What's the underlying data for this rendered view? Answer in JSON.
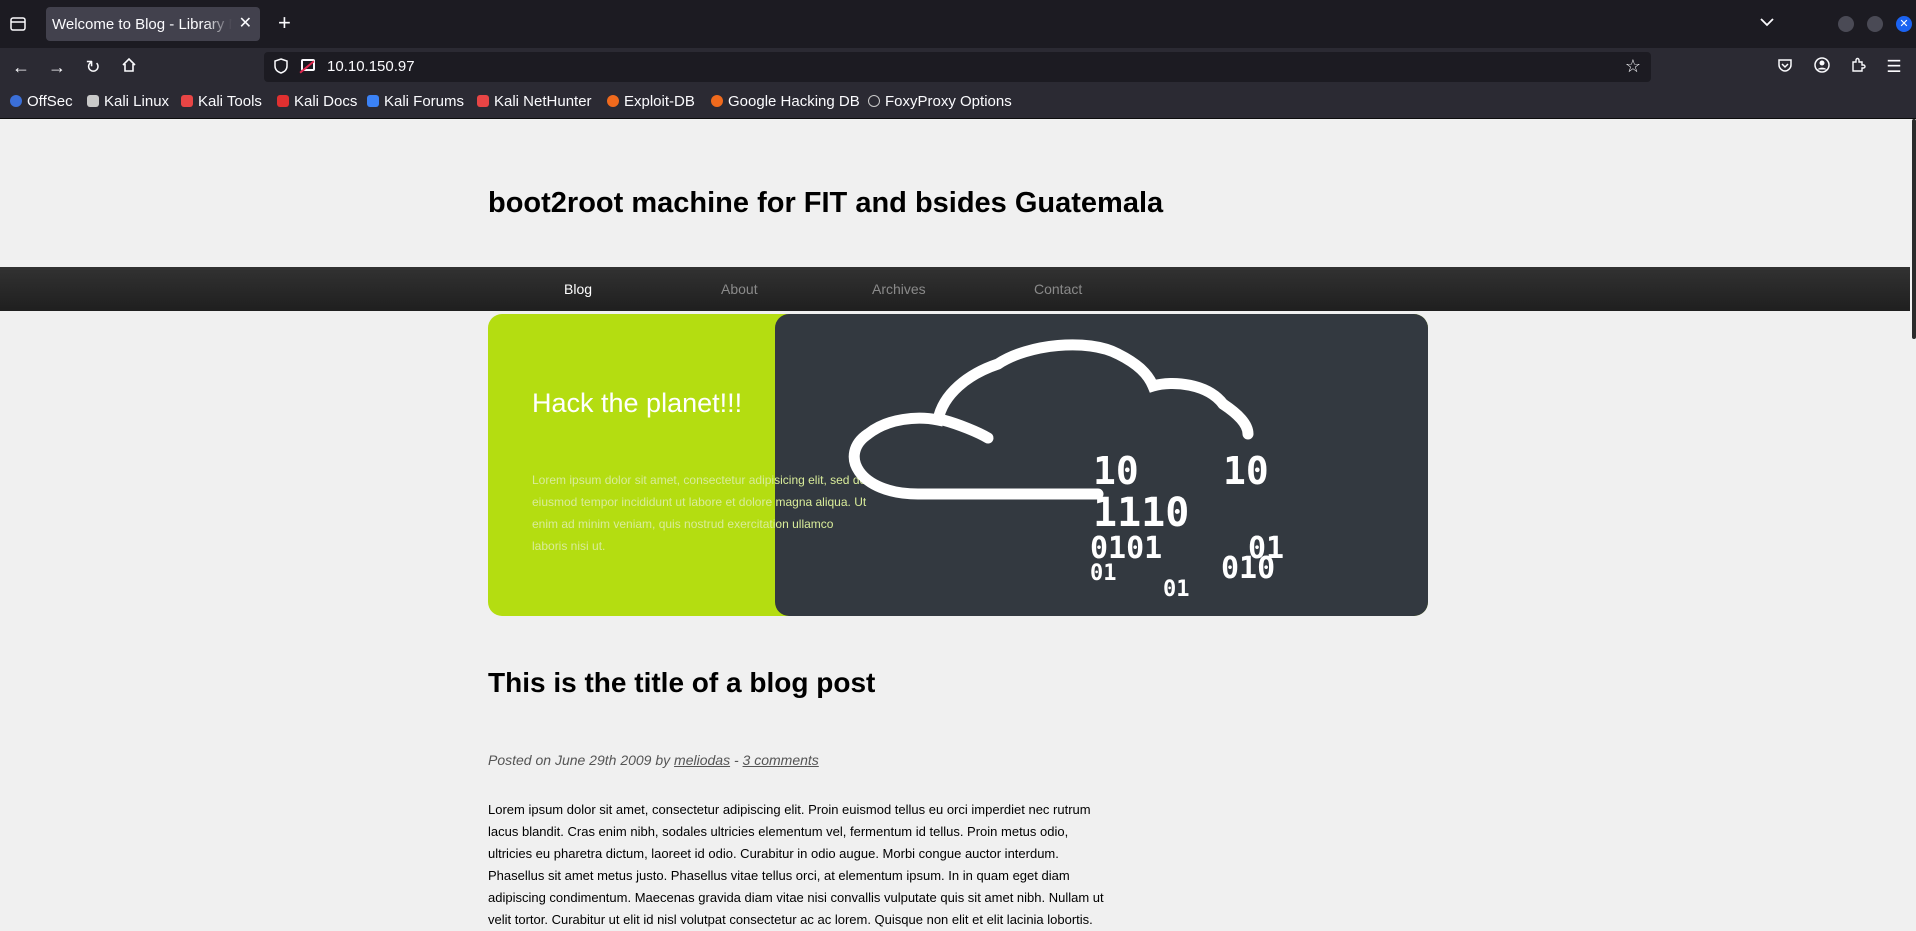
{
  "browser": {
    "tab_title": "Welcome to Blog - Library Machine",
    "url": "10.10.150.97",
    "bookmarks": [
      {
        "label": "OffSec",
        "icon": "offsec-icon",
        "color": "#3b6fd8"
      },
      {
        "label": "Kali Linux",
        "icon": "kali-dragon-icon",
        "color": "#c9c9c9"
      },
      {
        "label": "Kali Tools",
        "icon": "kali-tools-icon",
        "color": "#e84545"
      },
      {
        "label": "Kali Docs",
        "icon": "kali-docs-icon",
        "color": "#e03030"
      },
      {
        "label": "Kali Forums",
        "icon": "kali-forums-icon",
        "color": "#3b82f6"
      },
      {
        "label": "Kali NetHunter",
        "icon": "kali-nethunter-icon",
        "color": "#e84545"
      },
      {
        "label": "Exploit-DB",
        "icon": "exploit-db-icon",
        "color": "#f06a1d"
      },
      {
        "label": "Google Hacking DB",
        "icon": "ghdb-icon",
        "color": "#f06a1d"
      },
      {
        "label": "FoxyProxy Options",
        "icon": "globe-icon",
        "color": "#c9c9c9"
      }
    ]
  },
  "site": {
    "title": "boot2root machine for FIT and bsides Guatemala",
    "menu": [
      "Blog",
      "About",
      "Archives",
      "Contact"
    ],
    "active_menu": "Blog"
  },
  "hero": {
    "title": "Hack the planet!!!",
    "text": "Lorem ipsum dolor sit amet, consectetur adipisicing elit, sed do eiusmod tempor incididunt ut labore et dolore magna aliqua. Ut enim ad minim veniam, quis nostrud exercitation ullamco laboris nisi ut.",
    "art_digits": [
      "10",
      "10",
      "1110",
      "0101",
      "01",
      "01",
      "010",
      "01"
    ],
    "colors": {
      "accent": "#b4dd11",
      "dark": "#333940"
    }
  },
  "post": {
    "title": "This is the title of a blog post",
    "meta_prefix": "Posted on June 29th 2009 by",
    "author": "meliodas",
    "meta_sep": "-",
    "comments": "3 comments",
    "body": "Lorem ipsum dolor sit amet, consectetur adipiscing elit. Proin euismod tellus eu orci imperdiet nec rutrum lacus blandit. Cras enim nibh, sodales ultricies elementum vel, fermentum id tellus. Proin metus odio, ultricies eu pharetra dictum, laoreet id odio. Curabitur in odio augue. Morbi congue auctor interdum. Phasellus sit amet metus justo. Phasellus vitae tellus orci, at elementum ipsum. In in quam eget diam adipiscing condimentum. Maecenas gravida diam vitae nisi convallis vulputate quis sit amet nibh. Nullam ut velit tortor. Curabitur ut elit id nisl volutpat consectetur ac ac lorem. Quisque non elit et elit lacinia lobortis."
  }
}
